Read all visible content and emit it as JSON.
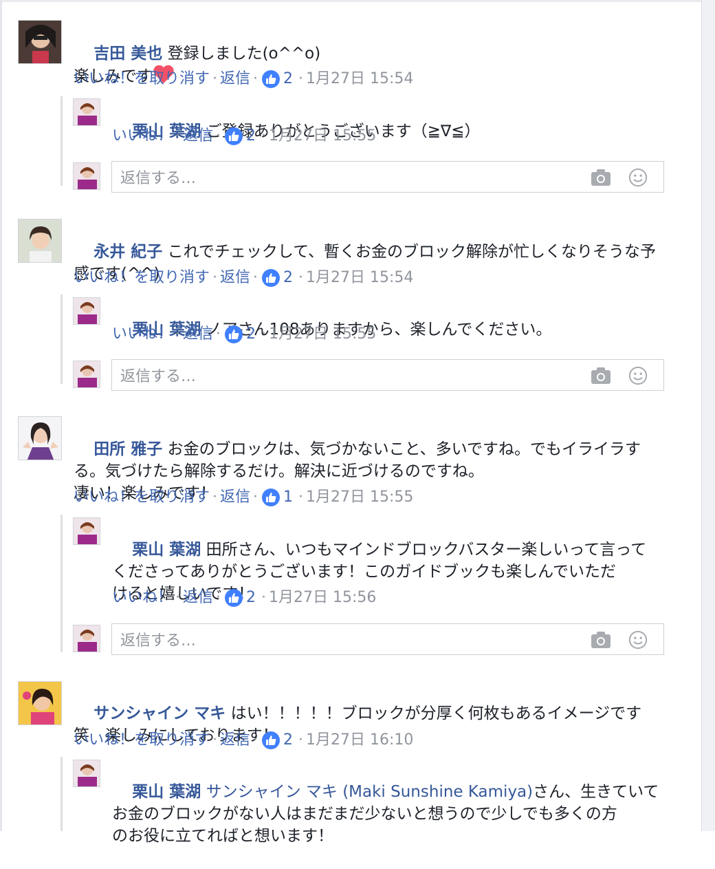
{
  "actions": {
    "unlike_label": "いいね！を取り消す",
    "like_label": "いいね！",
    "reply_label": "返信",
    "dot": "·"
  },
  "reply_placeholder": "返信する…",
  "comments": [
    {
      "name": "吉田 美也",
      "text_line1": "登録しました(o^^o)",
      "text_line2": "楽しみです",
      "emoji": "heart",
      "likes": "2",
      "time": "1月27日 15:54",
      "reply": {
        "name": "栗山 葉湖",
        "text": "ご登録ありがとうございます（≧∇≦）",
        "likes": "2",
        "time": "1月27日 15:55"
      }
    },
    {
      "name": "永井 紀子",
      "text_line1": "これでチェックして、暫くお金のブロック解除が忙しくなりそうな予",
      "text_line2": "感です(^^)",
      "likes": "2",
      "time": "1月27日 15:54",
      "reply": {
        "name": "栗山 葉湖",
        "text": "ノアさん108ありますから、楽しんでください。",
        "likes": "2",
        "time": "1月27日 15:55"
      }
    },
    {
      "name": "田所 雅子",
      "text_line1": "お金のブロックは、気づかないこと、多いですね。でもイライラす",
      "text_line2": "る。気づけたら解除するだけ。解決に近づけるのですね。",
      "text_line3": "凄い！楽しみです！",
      "likes": "1",
      "time": "1月27日 15:55",
      "reply": {
        "name": "栗山 葉湖",
        "text_line1": "田所さん、いつもマインドブロックバスター楽しいって言って",
        "text_line2": "くださってありがとうございます！このガイドブックも楽しんでいただ",
        "text_line3": "けると嬉しいです！",
        "likes": "2",
        "time": "1月27日 15:56"
      }
    },
    {
      "name": "サンシャイン マキ",
      "text_line1": "はい！！！！！ブロックが分厚く何枚もあるイメージです",
      "text_line2": "笑　楽しみにしております！",
      "likes": "2",
      "time": "1月27日 16:10",
      "reply": {
        "name": "栗山 葉湖",
        "mention": "サンシャイン マキ (Maki Sunshine Kamiya)",
        "text_line1": "さん、生きていて",
        "text_line2": "お金のブロックがない人はまだまだ少ないと想うので少しでも多くの方",
        "text_line3": "のお役に立てればと想います！"
      }
    }
  ],
  "colors": {
    "name": "#365899",
    "link": "#4267b2",
    "meta": "#90949c",
    "like_badge": "#4080ff",
    "heart": "#f25268"
  }
}
